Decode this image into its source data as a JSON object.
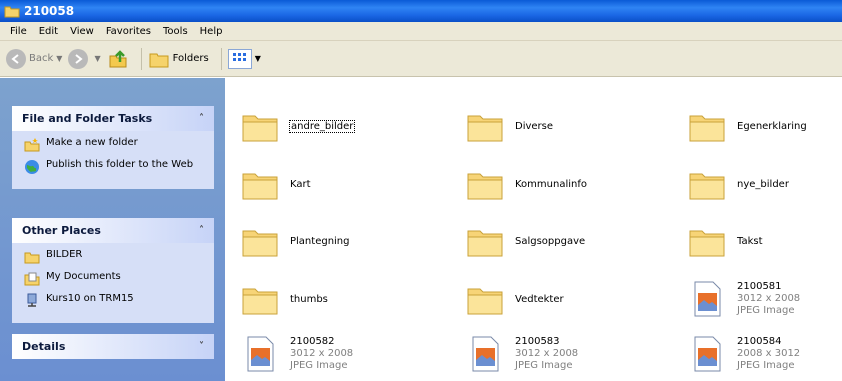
{
  "window": {
    "title": "210058"
  },
  "menu": [
    "File",
    "Edit",
    "View",
    "Favorites",
    "Tools",
    "Help"
  ],
  "toolbar": {
    "back": "Back",
    "folders": "Folders"
  },
  "tasks": {
    "title": "File and Folder Tasks",
    "items": [
      "Make a new folder",
      "Publish this folder to the Web"
    ]
  },
  "places": {
    "title": "Other Places",
    "items": [
      "BILDER",
      "My Documents",
      "Kurs10 on TRM15"
    ]
  },
  "details": {
    "title": "Details"
  },
  "files": [
    {
      "name": "andre_bilder"
    },
    {
      "name": "Diverse"
    },
    {
      "name": "Egenerklaring"
    },
    {
      "name": "Kart"
    },
    {
      "name": "Kommunalinfo"
    },
    {
      "name": "nye_bilder"
    },
    {
      "name": "Plantegning"
    },
    {
      "name": "Salgsoppgave"
    },
    {
      "name": "Takst"
    },
    {
      "name": "thumbs"
    },
    {
      "name": "Vedtekter"
    },
    {
      "name": "2100581",
      "dims": "3012 x 2008",
      "kind": "JPEG Image"
    },
    {
      "name": "2100582",
      "dims": "3012 x 2008",
      "kind": "JPEG Image"
    },
    {
      "name": "2100583",
      "dims": "3012 x 2008",
      "kind": "JPEG Image"
    },
    {
      "name": "2100584",
      "dims": "2008 x 3012",
      "kind": "JPEG Image"
    }
  ]
}
